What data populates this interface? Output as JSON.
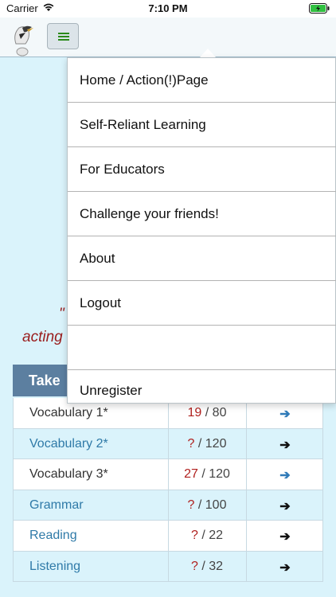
{
  "status_bar": {
    "carrier": "Carrier",
    "time": "7:10 PM"
  },
  "headline": {
    "quote_mark": "\"",
    "acting": "acting"
  },
  "table": {
    "header": "Take",
    "rows": [
      {
        "name": "Vocabulary 1*",
        "score": "19",
        "total": " / 80",
        "style": "dark",
        "arrow": "➔",
        "arrow_color": "blue"
      },
      {
        "name": "Vocabulary 2*",
        "score": "?",
        "total": " / 120",
        "style": "link",
        "arrow": "➔",
        "arrow_color": "black"
      },
      {
        "name": "Vocabulary 3*",
        "score": "27",
        "total": " / 120",
        "style": "dark",
        "arrow": "➔",
        "arrow_color": "blue"
      },
      {
        "name": "Grammar",
        "score": "?",
        "total": " / 100",
        "style": "link",
        "arrow": "➔",
        "arrow_color": "black"
      },
      {
        "name": "Reading",
        "score": "?",
        "total": " / 22",
        "style": "link",
        "arrow": "➔",
        "arrow_color": "black"
      },
      {
        "name": "Listening",
        "score": "?",
        "total": " / 32",
        "style": "link",
        "arrow": "➔",
        "arrow_color": "black"
      }
    ]
  },
  "menu": {
    "items": [
      {
        "label": "Home / Action(!)Page"
      },
      {
        "label": "Self-Reliant Learning"
      },
      {
        "label": "For Educators"
      },
      {
        "label": "Challenge your friends!"
      },
      {
        "label": "About"
      },
      {
        "label": "Logout"
      },
      {
        "label": ""
      },
      {
        "label": "Unregister"
      }
    ]
  },
  "colors": {
    "background": "#daf3fb",
    "header": "#5c7fa0",
    "accent_red": "#b0201e",
    "link_blue": "#2f7aa8"
  },
  "icons": {
    "wifi": "wifi-icon",
    "battery": "battery-charging-icon",
    "menu": "hamburger-menu-icon",
    "logo": "bird-logo-icon",
    "arrow": "arrow-right-icon"
  }
}
